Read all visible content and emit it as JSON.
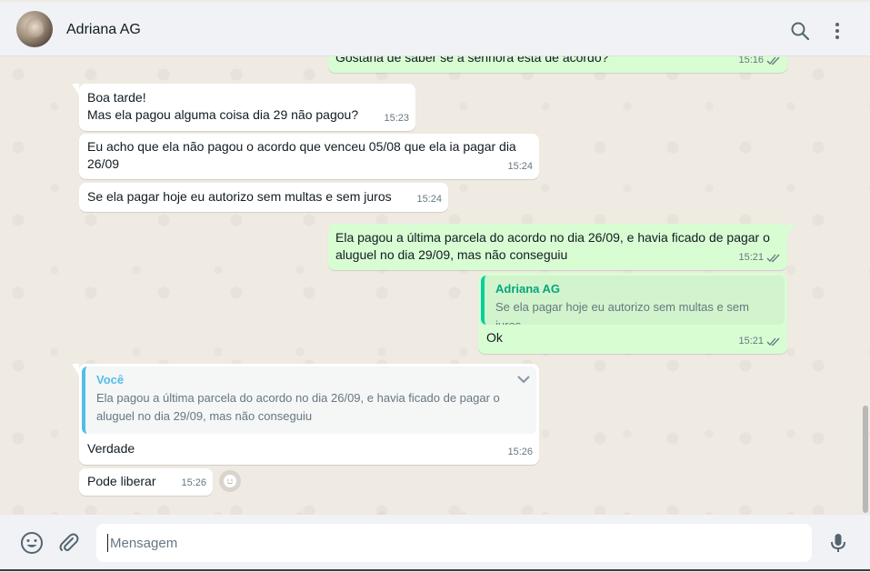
{
  "header": {
    "contact_name": "Adriana AG",
    "avatar_icon": "contact-photo",
    "search_icon": "search-icon",
    "menu_icon": "kebab-menu-icon"
  },
  "messages": {
    "partial_out": {
      "text": "Gostaria de saber se a senhora está de acordo?",
      "time": "15:16"
    },
    "in1": {
      "text": "Boa tarde!\nMas ela pagou alguma coisa dia 29 não pagou?",
      "time": "15:23"
    },
    "in2": {
      "text": "Eu acho que ela não pagou o acordo que venceu 05/08 que ela ia pagar dia\n26/09",
      "time": "15:24"
    },
    "in3": {
      "text": "Se ela pagar hoje eu autorizo sem multas e sem juros",
      "time": "15:24"
    },
    "out1": {
      "text": "Ela pagou a última parcela do acordo no dia 26/09, e havia ficado de pagar o\naluguel no dia 29/09, mas não conseguiu",
      "time": "15:21"
    },
    "out2": {
      "quote_author": "Adriana AG",
      "quote_text": "Se ela pagar hoje eu autorizo sem multas e sem juros",
      "text": "Ok",
      "time": "15:21"
    },
    "in4": {
      "quote_author": "Você",
      "quote_text": "Ela pagou a última parcela do acordo no dia 26/09, e havia ficado de pagar o\naluguel no dia 29/09, mas não conseguiu",
      "text": "Verdade",
      "time": "15:26"
    },
    "in5": {
      "text": "Pode liberar",
      "time": "15:26"
    }
  },
  "composer": {
    "placeholder": "Mensagem",
    "emoji_icon": "emoji-icon",
    "attach_icon": "paperclip-icon",
    "mic_icon": "microphone-icon"
  },
  "colors": {
    "incoming_bubble": "#ffffff",
    "outgoing_bubble": "#d9fdd3",
    "read_ticks": "#53bdeb",
    "quote_author_out": "#06cf9c",
    "quote_author_in": "#53bdeb"
  }
}
